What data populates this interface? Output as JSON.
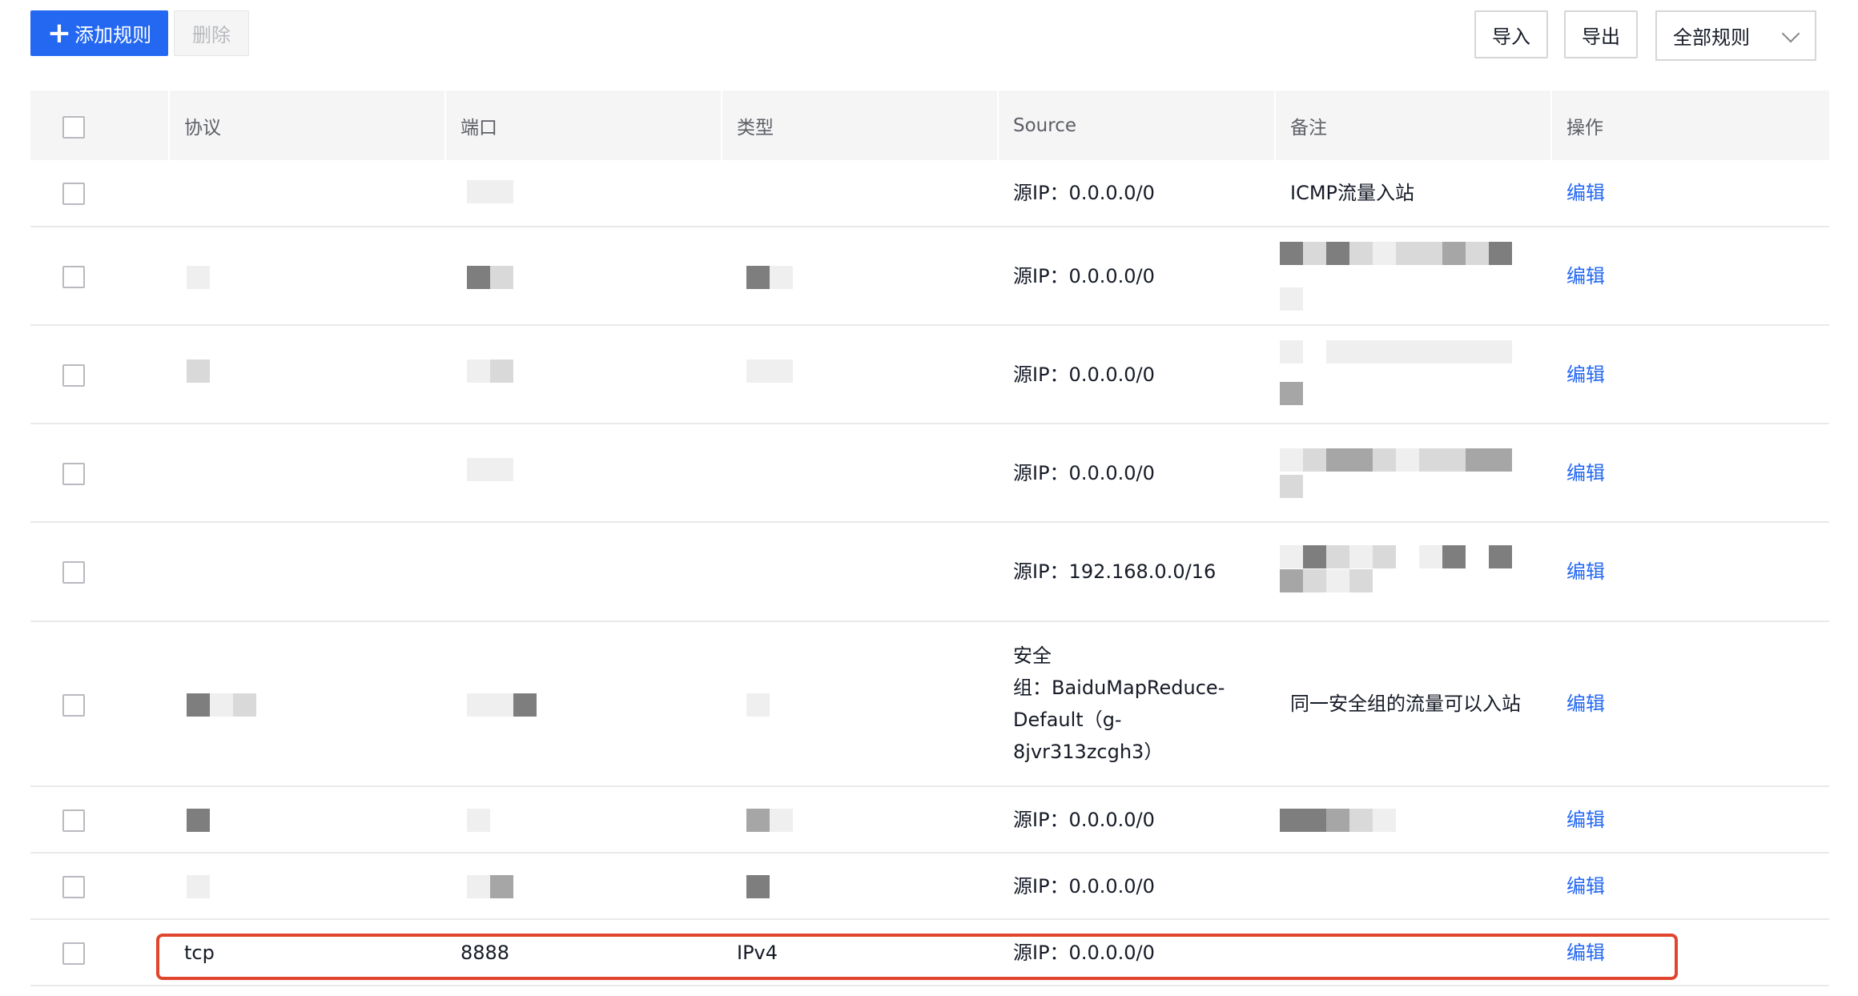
{
  "toolbar": {
    "add_label": "添加规则",
    "delete_label": "删除",
    "import_label": "导入",
    "export_label": "导出",
    "filter_value": "全部规则"
  },
  "table": {
    "headers": [
      "协议",
      "端口",
      "类型",
      "Source",
      "备注",
      "操作"
    ],
    "rows": [
      {
        "protocol": "",
        "port": "",
        "type": "",
        "source": "源IP：0.0.0.0/0",
        "note": "ICMP流量入站",
        "action": "编辑"
      },
      {
        "protocol": "",
        "port": "",
        "type": "",
        "source": "源IP：0.0.0.0/0",
        "note": "",
        "action": "编辑"
      },
      {
        "protocol": "",
        "port": "",
        "type": "",
        "source": "源IP：0.0.0.0/0",
        "note": "",
        "action": "编辑"
      },
      {
        "protocol": "",
        "port": "",
        "type": "",
        "source": "源IP：0.0.0.0/0",
        "note": "",
        "action": "编辑"
      },
      {
        "protocol": "",
        "port": "",
        "type": "",
        "source": "源IP：192.168.0.0/16",
        "note": "",
        "action": "编辑"
      },
      {
        "protocol": "",
        "port": "",
        "type": "",
        "source": "安全\n组：BaiduMapReduce-\nDefault（g-\n8jvr313zcgh3）",
        "note": "同一安全组的流量可以入站",
        "action": "编辑"
      },
      {
        "protocol": "",
        "port": "",
        "type": "",
        "source": "源IP：0.0.0.0/0",
        "note": "",
        "action": "编辑"
      },
      {
        "protocol": "",
        "port": "",
        "type": "",
        "source": "源IP：0.0.0.0/0",
        "note": "",
        "action": "编辑"
      },
      {
        "protocol": "tcp",
        "port": "8888",
        "type": "IPv4",
        "source": "源IP：0.0.0.0/0",
        "note": "",
        "action": "编辑"
      }
    ]
  },
  "icons": {
    "add": "plus-icon",
    "dropdown": "chevron-down-icon"
  },
  "colors": {
    "primary": "#2468f2",
    "highlight": "#e0452d"
  }
}
